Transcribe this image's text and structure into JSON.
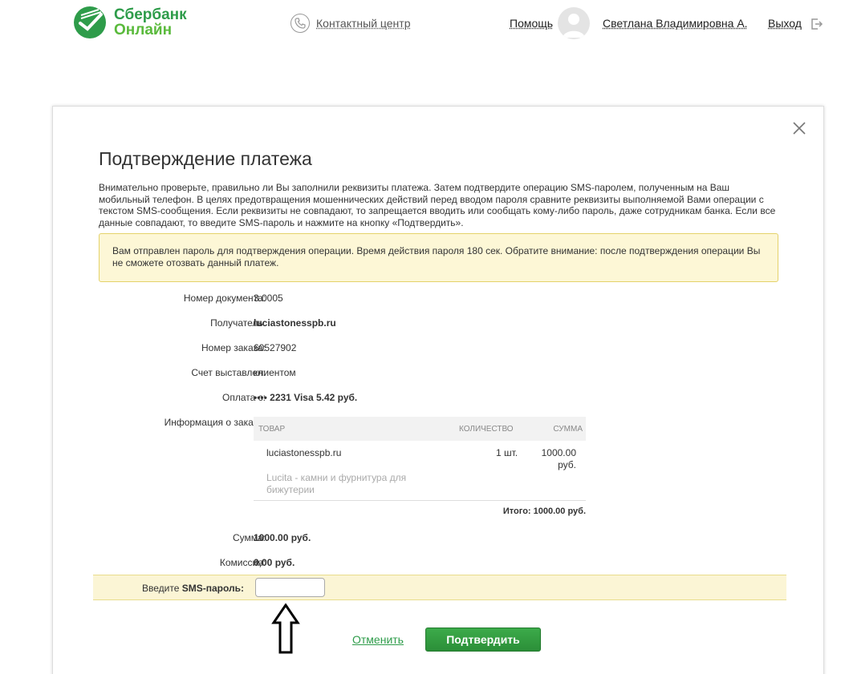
{
  "header": {
    "logo_line1": "Сбербанк",
    "logo_line2": "Онлайн",
    "contact_center": "Контактный центр",
    "help": "Помощь",
    "user_name": "Светлана Владимировна А.",
    "logout": "Выход"
  },
  "dialog": {
    "title": "Подтверждение платежа",
    "intro": "Внимательно проверьте, правильно ли Вы заполнили реквизиты платежа. Затем подтвердите операцию SMS-паролем, полученным на Ваш мобильный телефон. В целях предотвращения мошеннических действий перед вводом пароля сравните реквизиты выполняемой Вами операции с текстом SMS-сообщения. Если реквизиты не совпадают, то запрещается вводить или сообщать кому-либо пароль, даже сотрудникам банка. Если все данные совпадают, то введите SMS-пароль и нажмите на кнопку «Подтвердить».",
    "notice": "Вам отправлен пароль для подтверждения операции. Время действия пароля 180 сек. Обратите внимание: после подтверждения операции Вы не сможете отозвать данный платеж.",
    "fields": {
      "doc_number_label": "Номер документа:",
      "doc_number_value": "3.0005",
      "recipient_label": "Получатель:",
      "recipient_value": "luciastonesspb.ru",
      "order_number_label": "Номер заказа:",
      "order_number_value": "60527902",
      "invoiced_label": "Счет выставлен:",
      "invoiced_value": "клиентом",
      "payment_from_label": "Оплата с:",
      "payment_from_value": "•••• 2231 Visa 5.42 руб.",
      "order_info_label": "Информация о заказе:"
    },
    "order_table": {
      "col_item": "ТОВАР",
      "col_qty": "КОЛИЧЕСТВО",
      "col_sum": "СУММА",
      "item_name": "luciastonesspb.ru",
      "item_desc": "Lucita - камни и фурнитура для бижутерии",
      "item_qty": "1 шт.",
      "item_sum": "1000.00 руб.",
      "total": "Итого: 1000.00 руб."
    },
    "sum_label": "Сумма:",
    "sum_value": "1000.00 руб.",
    "commission_label": "Комиссия:",
    "commission_value": "0,00 руб.",
    "sms_label_prefix": "Введите ",
    "sms_label_bold": "SMS-пароль:",
    "sms_value": "",
    "cancel": "Отменить",
    "confirm": "Подтвердить"
  },
  "colors": {
    "brand_green": "#2e9c4a",
    "notice_bg": "#fdf7d6",
    "notice_border": "#e4d26a"
  }
}
